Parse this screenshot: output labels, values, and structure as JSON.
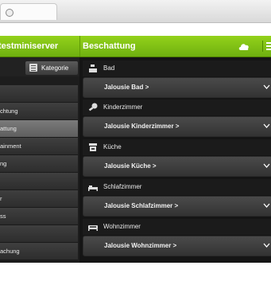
{
  "browser": {
    "tab_icon": "globe-icon"
  },
  "header": {
    "left_title": "testminiserver",
    "main_title": "Beschattung",
    "icons": [
      "cloud-icon",
      "menu-icon"
    ]
  },
  "left_panel": {
    "category_button": {
      "label": "Kategorie",
      "icon": "list-icon"
    },
    "items": [
      {
        "label": ""
      },
      {
        "label": "chtung"
      },
      {
        "label": "attung",
        "active": true
      },
      {
        "label": "ainment"
      },
      {
        "label": "ng"
      },
      {
        "label": ""
      },
      {
        "label": "r"
      },
      {
        "label": "ss"
      },
      {
        "label": ""
      },
      {
        "label": "achung"
      }
    ]
  },
  "groups": [
    {
      "name": "Bad",
      "icon": "bathroom-icon",
      "jalousie": "Jalousie Bad >"
    },
    {
      "name": "Kinderzimmer",
      "icon": "kids-room-icon",
      "jalousie": "Jalousie Kinderzimmer >"
    },
    {
      "name": "Küche",
      "icon": "kitchen-icon",
      "jalousie": "Jalousie Küche >"
    },
    {
      "name": "Schlafzimmer",
      "icon": "bed-icon",
      "jalousie": "Jalousie Schlafzimmer >"
    },
    {
      "name": "Wohnzimmer",
      "icon": "sofa-icon",
      "jalousie": "Jalousie Wohnzimmer >"
    }
  ],
  "colors": {
    "accent_green": "#7fc31c",
    "background": "#151515"
  }
}
